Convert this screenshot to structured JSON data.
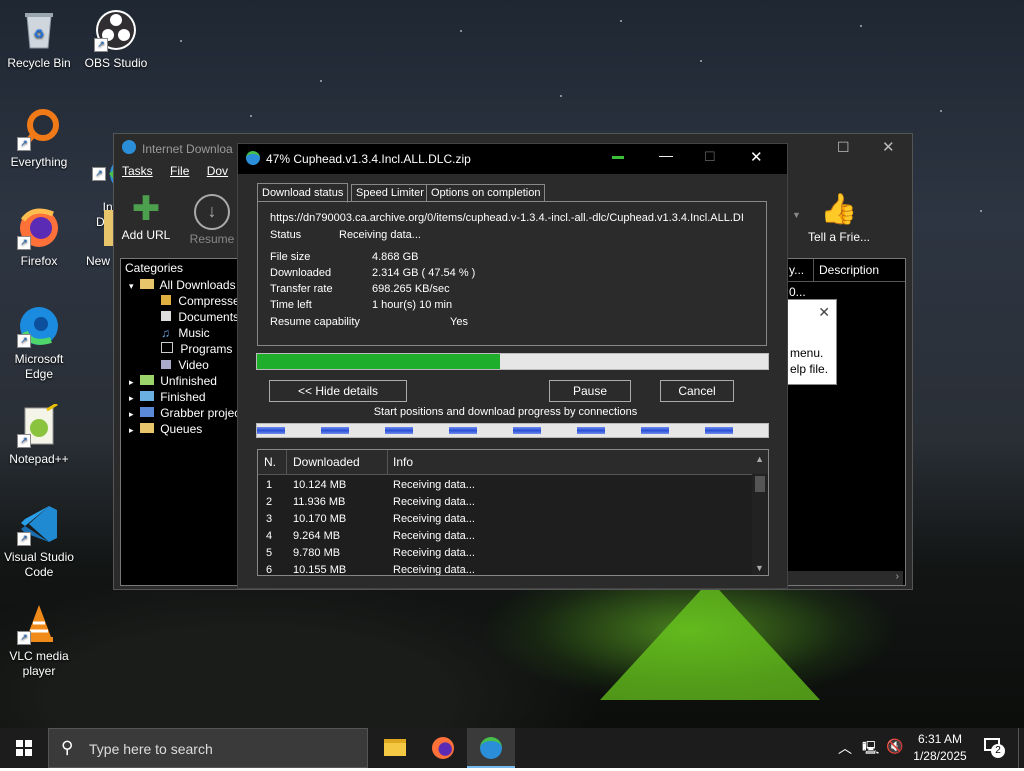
{
  "desktop": {
    "icons": [
      {
        "label": "Recycle Bin"
      },
      {
        "label": "OBS Studio"
      },
      {
        "label": "Everything"
      },
      {
        "label": "Inte\nDow"
      },
      {
        "label": "Firefox"
      },
      {
        "label": "New"
      },
      {
        "label": "Microsoft Edge"
      },
      {
        "label": "Notepad++"
      },
      {
        "label": "Visual Studio Code"
      },
      {
        "label": "VLC media player"
      }
    ]
  },
  "idm_main": {
    "title": "Internet Downloa",
    "menu": [
      "Tasks",
      "File",
      "Dov"
    ],
    "toolbar": {
      "add_url": "Add URL",
      "resume": "Resume",
      "tell_friend": "Tell a Frie..."
    },
    "categories_header": "Categories",
    "categories": [
      {
        "label": "All Downloads"
      },
      {
        "label": "Compresse"
      },
      {
        "label": "Documents"
      },
      {
        "label": "Music"
      },
      {
        "label": "Programs"
      },
      {
        "label": "Video"
      },
      {
        "label": "Unfinished"
      },
      {
        "label": "Finished"
      },
      {
        "label": "Grabber projec"
      },
      {
        "label": "Queues"
      }
    ],
    "right_columns": {
      "col1": "y...",
      "col2": "Description",
      "row_val": "0..."
    },
    "popup_text": {
      "line1": "menu.",
      "line2": "elp file."
    }
  },
  "dialog": {
    "title": "47% Cuphead.v1.3.4.Incl.ALL.DLC.zip",
    "tabs": [
      "Download status",
      "Speed Limiter",
      "Options on completion"
    ],
    "url": "https://dn790003.ca.archive.org/0/items/cuphead.v-1.3.4.-incl.-all.-dlc/Cuphead.v1.3.4.Incl.ALL.DI",
    "status_label": "Status",
    "status_value": "Receiving data...",
    "file_size_label": "File size",
    "file_size_value": "4.868  GB",
    "downloaded_label": "Downloaded",
    "downloaded_value": "2.314  GB  ( 47.54 % )",
    "transfer_label": "Transfer rate",
    "transfer_value": "698.265  KB/sec",
    "time_left_label": "Time left",
    "time_left_value": "1 hour(s) 10 min",
    "resume_label": "Resume capability",
    "resume_value": "Yes",
    "progress": 0.4754,
    "buttons": {
      "hide_details": "<< Hide details",
      "pause": "Pause",
      "cancel": "Cancel"
    },
    "connections_caption": "Start positions and download progress by connections",
    "table_headers": [
      "N.",
      "Downloaded",
      "Info"
    ],
    "rows": [
      {
        "n": "1",
        "downloaded": "10.124  MB",
        "info": "Receiving data..."
      },
      {
        "n": "2",
        "downloaded": "11.936  MB",
        "info": "Receiving data..."
      },
      {
        "n": "3",
        "downloaded": "10.170  MB",
        "info": "Receiving data..."
      },
      {
        "n": "4",
        "downloaded": "9.264  MB",
        "info": "Receiving data..."
      },
      {
        "n": "5",
        "downloaded": "9.780  MB",
        "info": "Receiving data..."
      },
      {
        "n": "6",
        "downloaded": "10.155  MB",
        "info": "Receiving data..."
      }
    ]
  },
  "taskbar": {
    "search_placeholder": "Type here to search",
    "time": "6:31 AM",
    "date": "1/28/2025",
    "notification_count": "2"
  },
  "colors": {
    "progress": "#1fae2c",
    "conn_blue": "#2a4fd6",
    "dialog_bg": "#2b2b2b"
  }
}
